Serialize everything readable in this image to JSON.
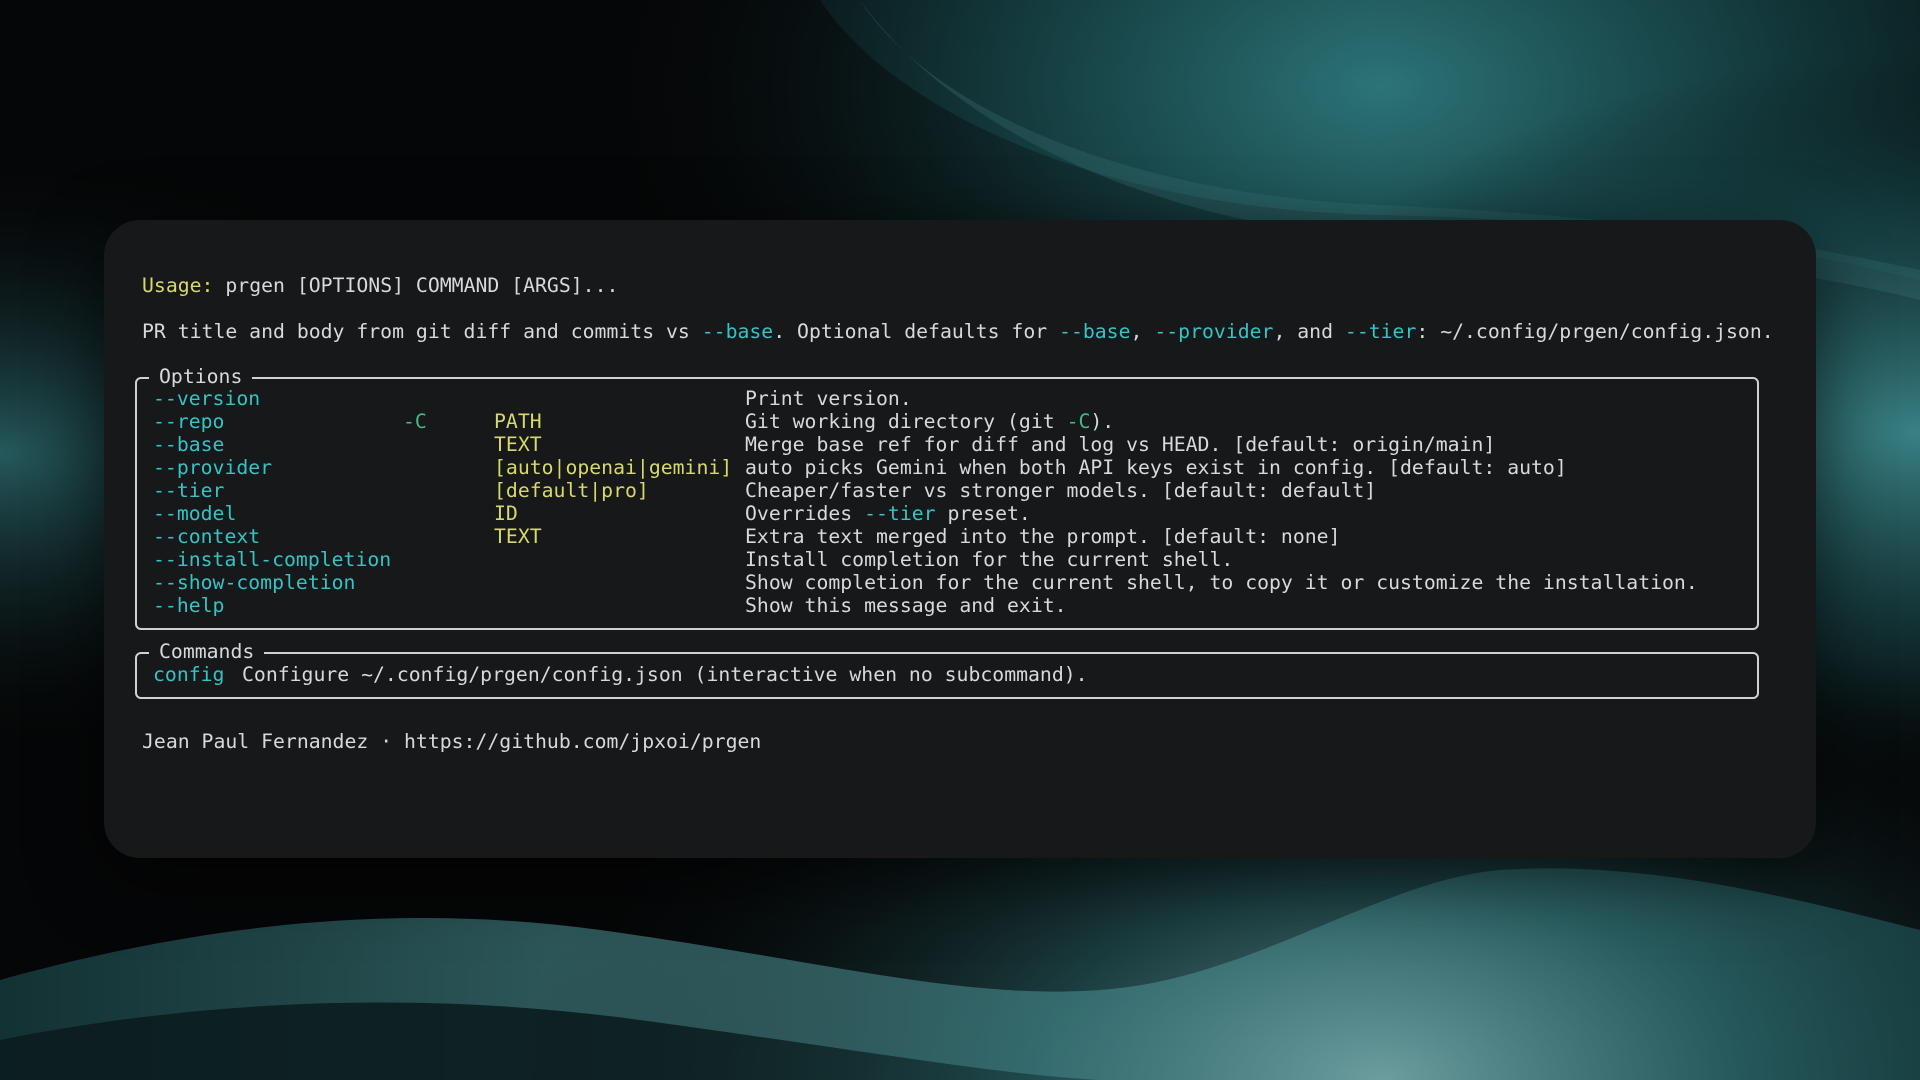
{
  "colors": {
    "accent_flag": "#35c3c6",
    "accent_metavar": "#d9d86a",
    "accent_short": "#43b98a",
    "text": "#d7d9da",
    "terminal_bg": "#171819"
  },
  "usage": {
    "label": "Usage:",
    "rest": " prgen [OPTIONS] COMMAND [ARGS]..."
  },
  "description": {
    "t1": "PR title and body from git diff and commits vs ",
    "f1": "--base",
    "t2": ". Optional defaults for ",
    "f2": "--base",
    "t3": ", ",
    "f3": "--provider",
    "t4": ", and ",
    "f4": "--tier",
    "t5": ": ~/.config/prgen/config.json."
  },
  "options": {
    "title": "Options",
    "rows": [
      {
        "long": "--version",
        "short": "",
        "metavar": "",
        "help": "Print version."
      },
      {
        "long": "--repo",
        "short": "-C",
        "metavar": "PATH",
        "help_pre": "Git working directory (git ",
        "help_hl": "-C",
        "help_post": ")."
      },
      {
        "long": "--base",
        "short": "",
        "metavar": "TEXT",
        "help": "Merge base ref for diff and log vs HEAD. [default: origin/main]"
      },
      {
        "long": "--provider",
        "short": "",
        "metavar": "[auto|openai|gemini]",
        "help": "auto picks Gemini when both API keys exist in config. [default: auto]"
      },
      {
        "long": "--tier",
        "short": "",
        "metavar": "[default|pro]",
        "help": "Cheaper/faster vs stronger models. [default: default]"
      },
      {
        "long": "--model",
        "short": "",
        "metavar": "ID",
        "help_pre": "Overrides ",
        "help_hl": "--tier",
        "help_post": " preset."
      },
      {
        "long": "--context",
        "short": "",
        "metavar": "TEXT",
        "help": "Extra text merged into the prompt. [default: none]"
      },
      {
        "long": "--install-completion",
        "short": "",
        "metavar": "",
        "help": "Install completion for the current shell."
      },
      {
        "long": "--show-completion",
        "short": "",
        "metavar": "",
        "help": "Show completion for the current shell, to copy it or customize the installation."
      },
      {
        "long": "--help",
        "short": "",
        "metavar": "",
        "help": "Show this message and exit."
      }
    ]
  },
  "commands": {
    "title": "Commands",
    "rows": [
      {
        "name": "config",
        "help": "Configure ~/.config/prgen/config.json (interactive when no subcommand)."
      }
    ]
  },
  "footer": {
    "author": "Jean Paul Fernandez",
    "separator": " · ",
    "url": "https://github.com/jpxoi/prgen"
  }
}
